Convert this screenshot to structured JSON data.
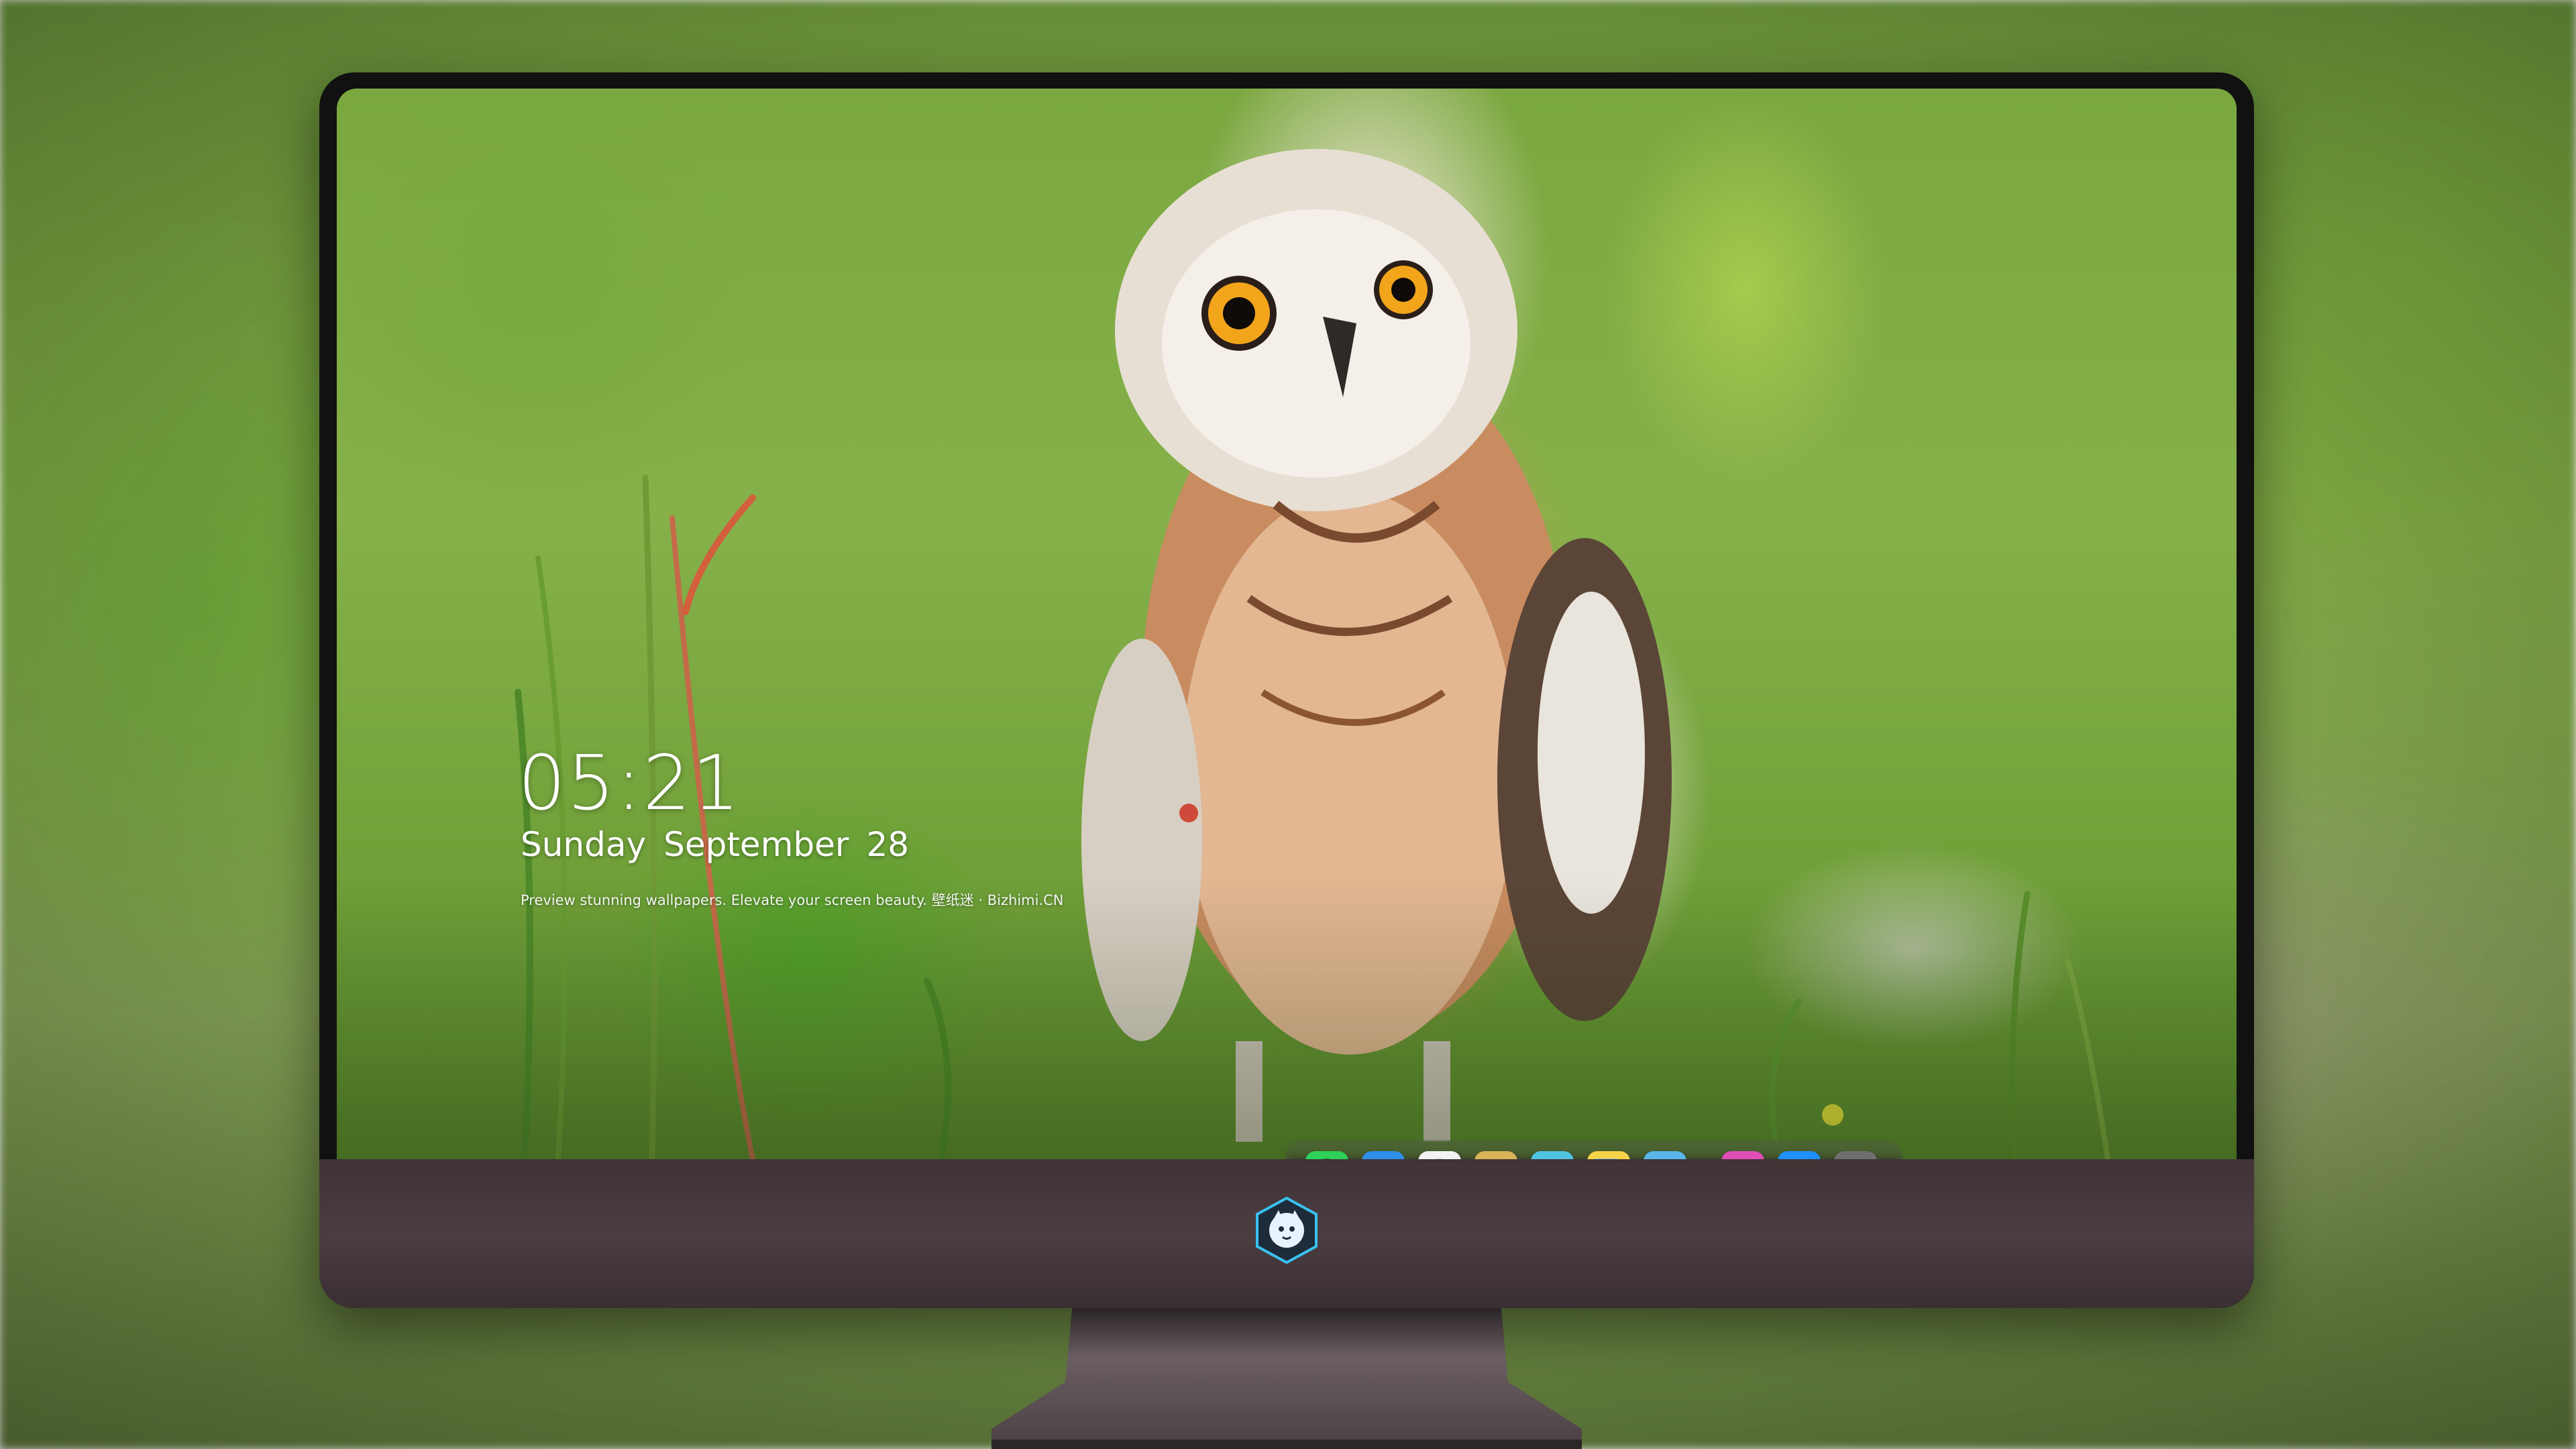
{
  "lock_screen": {
    "time": "05:21",
    "day": "Sunday",
    "month": "September",
    "date": "28",
    "caption": "Preview stunning wallpapers. Elevate your screen beauty. 壁纸迷 · Bizhimi.CN"
  },
  "dock": {
    "apps": [
      {
        "name": "messages-icon",
        "glyph": "💬",
        "color": "#2fd158"
      },
      {
        "name": "weather-icon",
        "glyph": "☁",
        "color": "#2f8fe8"
      },
      {
        "name": "clock-icon",
        "glyph": "🕒",
        "color": "#f2f2f2"
      },
      {
        "name": "preview-icon",
        "glyph": "🖼",
        "color": "#d8b35a"
      },
      {
        "name": "clapper-icon",
        "glyph": "🎬",
        "color": "#4fc3e0"
      },
      {
        "name": "notes-icon",
        "glyph": "📝",
        "color": "#f7d34a"
      },
      {
        "name": "photos-grid-icon",
        "glyph": "▦",
        "color": "#58b6e8"
      },
      {
        "name": "music-icon",
        "glyph": "♫",
        "color": "#e04fb5"
      },
      {
        "name": "app-store-icon",
        "glyph": "Ⓐ",
        "color": "#1e90ff"
      },
      {
        "name": "camera-icon",
        "glyph": "📷",
        "color": "#6f6f6f"
      }
    ]
  },
  "brand": {
    "logo": "mascot-logo-icon"
  },
  "colors": {
    "chin": "#43373a",
    "bezel": "#111111",
    "stand": "#5e5255"
  }
}
